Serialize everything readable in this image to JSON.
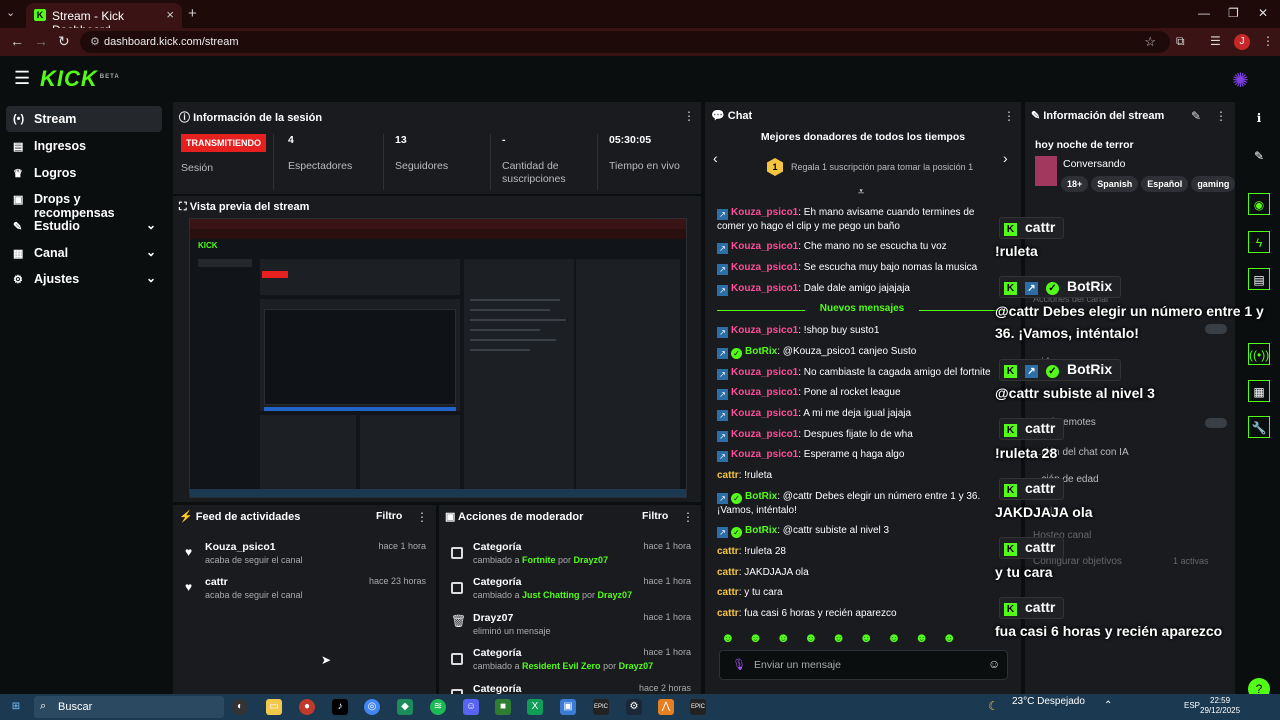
{
  "browser": {
    "tab_title": "Stream - Kick Dashboard",
    "url": "dashboard.kick.com/stream",
    "profile_initial": "J"
  },
  "header": {
    "logo": "KICK",
    "logo_sup": "BETA"
  },
  "sidebar": {
    "items": [
      {
        "label": "Stream"
      },
      {
        "label": "Ingresos"
      },
      {
        "label": "Logros"
      },
      {
        "label": "Drops y recompensas"
      },
      {
        "label": "Estudio"
      },
      {
        "label": "Canal"
      },
      {
        "label": "Ajustes"
      }
    ]
  },
  "session": {
    "title": "Información de la sesión",
    "status_badge": "TRANSMITIENDO",
    "status_label": "Sesión",
    "spectators_value": "4",
    "spectators_label": "Espectadores",
    "followers_value": "13",
    "followers_label": "Seguidores",
    "subs_value": "-",
    "subs_label": "Cantidad de suscripciones",
    "time_value": "05:30:05",
    "time_label": "Tiempo en vivo"
  },
  "preview": {
    "title": "Vista previa del stream"
  },
  "feed": {
    "title": "Feed de actividades",
    "filter": "Filtro",
    "items": [
      {
        "name": "Kouza_psico1",
        "sub": "acaba de seguir el canal",
        "time": "hace 1 hora"
      },
      {
        "name": "cattr",
        "sub": "acaba de seguir el canal",
        "time": "hace 23 horas"
      }
    ]
  },
  "mod": {
    "title": "Acciones de moderador",
    "filter": "Filtro",
    "items": [
      {
        "title": "Categoría",
        "pre": "cambiado a ",
        "target": "Fortnite",
        "mid": " por ",
        "by": "Drayz07",
        "time": "hace 1 hora"
      },
      {
        "title": "Categoría",
        "pre": "cambiado a ",
        "target": "Just Chatting",
        "mid": " por ",
        "by": "Drayz07",
        "time": "hace 1 hora"
      },
      {
        "title": "Drayz07",
        "pre": "eliminó un mensaje",
        "target": "",
        "mid": "",
        "by": "",
        "time": "hace 1 hora"
      },
      {
        "title": "Categoría",
        "pre": "cambiado a ",
        "target": "Resident Evil Zero",
        "mid": " por ",
        "by": "Drayz07",
        "time": "hace 1 hora"
      },
      {
        "title": "Categoría",
        "pre": "",
        "target": "",
        "mid": "",
        "by": "",
        "time": "hace 2 horas"
      }
    ]
  },
  "chat": {
    "title": "Chat",
    "donors_title": "Mejores donadores de todos los tiempos",
    "donors_rank": "1",
    "donors_text": "Regala 1 suscripción para tomar la posición 1",
    "new_messages": "Nuevos mensajes",
    "input_placeholder": "Enviar un mensaje",
    "messages": [
      {
        "user": "Kouza_psico1",
        "text": ": Eh mano avisame cuando termines de comer yo hago el clip y me pego un baño"
      },
      {
        "user": "Kouza_psico1",
        "text": ": Che mano no se escucha tu voz"
      },
      {
        "user": "Kouza_psico1",
        "text": ": Se escucha muy bajo nomas la musica"
      },
      {
        "user": "Kouza_psico1",
        "text": ": Dale dale amigo jajajaja"
      },
      {
        "user": "Kouza_psico1",
        "text": ": !shop buy susto1"
      },
      {
        "user": "BotRix",
        "text": ": @Kouza_psico1 canjeo Susto"
      },
      {
        "user": "Kouza_psico1",
        "text": ": No cambiaste la cagada amigo del fortnite"
      },
      {
        "user": "Kouza_psico1",
        "text": ": Pone al rocket league"
      },
      {
        "user": "Kouza_psico1",
        "text": ": A mi me deja igual jajaja"
      },
      {
        "user": "Kouza_psico1",
        "text": ": Despues fijate lo de wha"
      },
      {
        "user": "Kouza_psico1",
        "text": ": Esperame q haga algo"
      },
      {
        "user": "cattr",
        "text": ": !ruleta"
      },
      {
        "user": "BotRix",
        "text": ": @cattr Debes elegir un número entre 1 y 36. ¡Vamos, inténtalo!"
      },
      {
        "user": "BotRix",
        "text": ": @cattr subiste al nivel 3"
      },
      {
        "user": "cattr",
        "text": ": !ruleta 28"
      },
      {
        "user": "cattr",
        "text": ": JAKDJAJA ola"
      },
      {
        "user": "cattr",
        "text": ": y tu cara"
      },
      {
        "user": "cattr",
        "text": ": fua casi 6 horas y recién aparezco"
      }
    ]
  },
  "stream_info": {
    "title": "Información del stream",
    "stream_title": "hoy noche de terror",
    "category": "Conversando",
    "tags": [
      "18+",
      "Spanish",
      "Español",
      "gaming"
    ],
    "rows": [
      "Acciones del canal",
      "...idores",
      "...solo-emotes",
      "...ción del chat con IA",
      "...ción de edad",
      "...adas",
      "Hosteo canal",
      "Configurar objetivos",
      "1 activas"
    ]
  },
  "overlay": [
    {
      "name": "cattr",
      "msg": "!ruleta"
    },
    {
      "name": "BotRix",
      "msg": "@cattr Debes elegir un número entre 1 y"
    },
    {
      "name": "",
      "msg": "36. ¡Vamos, inténtalo!"
    },
    {
      "name": "BotRix",
      "msg": "@cattr subiste al nivel 3"
    },
    {
      "name": "cattr",
      "msg": "!ruleta 28"
    },
    {
      "name": "cattr",
      "msg": "JAKDJAJA ola"
    },
    {
      "name": "cattr",
      "msg": "y tu cara"
    },
    {
      "name": "cattr",
      "msg": "fua casi 6 horas y recién aparezco"
    }
  ],
  "taskbar": {
    "search": "Buscar",
    "weather": "23°C  Despejado",
    "lang": "ESP",
    "time": "22:59",
    "date": "29/12/2025"
  },
  "colors": {
    "kick_green": "#53fc18",
    "live_red": "#e5201f",
    "user_pink": "#ff4d9a"
  }
}
